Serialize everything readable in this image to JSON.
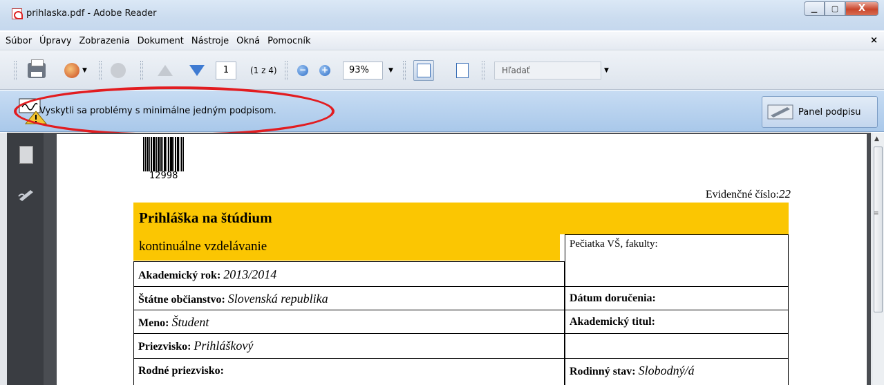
{
  "window": {
    "title": "prihlaska.pdf - Adobe Reader",
    "buttons": {
      "minimize": "▁",
      "maximize": "▢",
      "close": "X"
    }
  },
  "menu": {
    "items": [
      "Súbor",
      "Úpravy",
      "Zobrazenia",
      "Dokument",
      "Nástroje",
      "Okná",
      "Pomocník"
    ],
    "close": "×"
  },
  "toolbar": {
    "page": "1",
    "page_count": "(1 z 4)",
    "zoom_out": "−",
    "zoom_in": "+",
    "zoom": "93%",
    "search_placeholder": "Hľadať",
    "icons": [
      "print-icon",
      "share-icon",
      "tool-icon",
      "previous-page-icon",
      "next-page-icon",
      "fit-width-icon",
      "fit-page-icon"
    ]
  },
  "messagebar": {
    "text": "Vyskytli sa problémy s minimálne jedným podpisom.",
    "panel_button": "Panel podpisu"
  },
  "document": {
    "barcode_number": "12998",
    "evidence_label": "Evidenčné číslo:",
    "evidence_value": "22",
    "form_title": "Prihláška na štúdium",
    "form_subtitle": "kontinuálne vzdelávanie",
    "stamp_label": "Pečiatka VŠ, fakulty:",
    "rows_left": [
      {
        "label": "Akademický rok:",
        "value": "2013/2014"
      },
      {
        "label": "Štátne občianstvo:",
        "value": "Slovenská republika"
      },
      {
        "label": "Meno:",
        "value": "Študent"
      },
      {
        "label": "Priezvisko:",
        "value": "Prihláškový"
      },
      {
        "label": "Rodné priezvisko:",
        "value": ""
      }
    ],
    "rows_right": [
      {
        "label": "Dátum doručenia:",
        "value": ""
      },
      {
        "label": "Akademický titul:",
        "value": ""
      },
      {
        "label": "",
        "value": ""
      },
      {
        "label": "Rodinný stav:",
        "value": "Slobodný/á"
      }
    ]
  },
  "colors": {
    "form_header": "#fbc602",
    "highlight_ellipse": "#e21c20",
    "message_bar": "#a9c8ea"
  }
}
